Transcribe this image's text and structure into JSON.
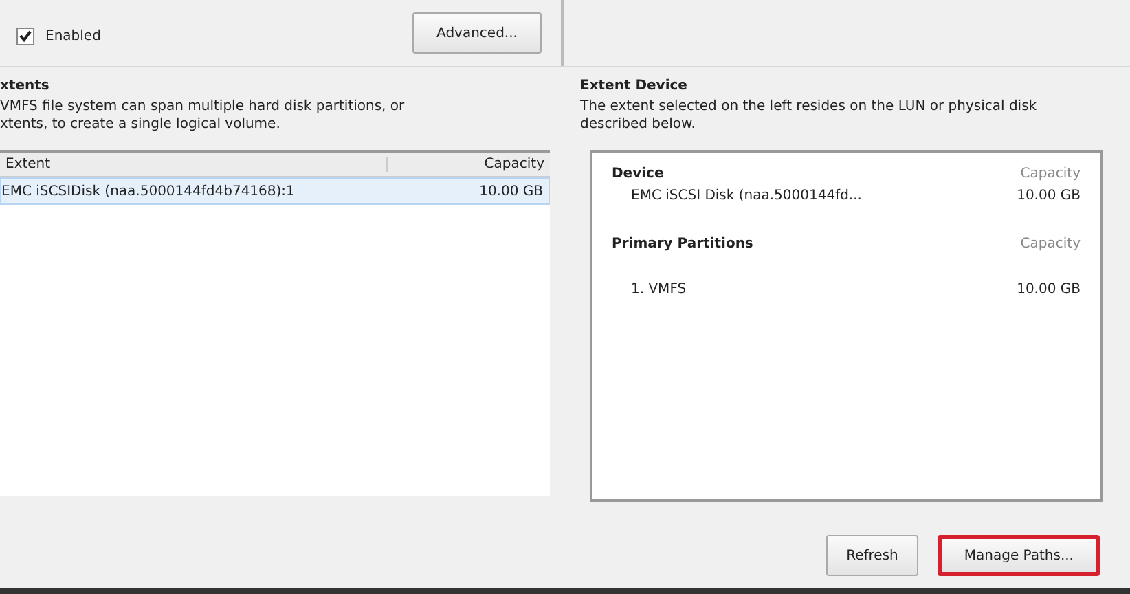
{
  "storage_io_control": {
    "checkbox": {
      "label": "Enabled",
      "checked": true
    },
    "advanced_button": "Advanced..."
  },
  "extents": {
    "title": "xtents",
    "description": " VMFS file system can span multiple hard disk partitions, or\nxtents, to create a single logical volume.",
    "columns": [
      "Extent",
      "Capacity"
    ],
    "rows": [
      {
        "extent": "EMC iSCSIDisk (naa.5000144fd4b74168):1",
        "capacity": "10.00 GB",
        "selected": true
      }
    ]
  },
  "extent_device": {
    "title": "Extent Device",
    "description": "The extent selected on the left resides on the LUN or physical disk described below.",
    "sections": [
      {
        "heading": "Device",
        "capacity_label": "Capacity",
        "items": [
          {
            "name": "EMC iSCSI Disk (naa.5000144fd...",
            "capacity": "10.00 GB"
          }
        ]
      },
      {
        "heading": "Primary Partitions",
        "capacity_label": "Capacity",
        "items": [
          {
            "name": "1. VMFS",
            "capacity": "10.00 GB"
          }
        ]
      }
    ]
  },
  "buttons": [
    {
      "label": "Refresh",
      "highlighted": false
    },
    {
      "label": "Manage Paths...",
      "highlighted": true
    }
  ]
}
